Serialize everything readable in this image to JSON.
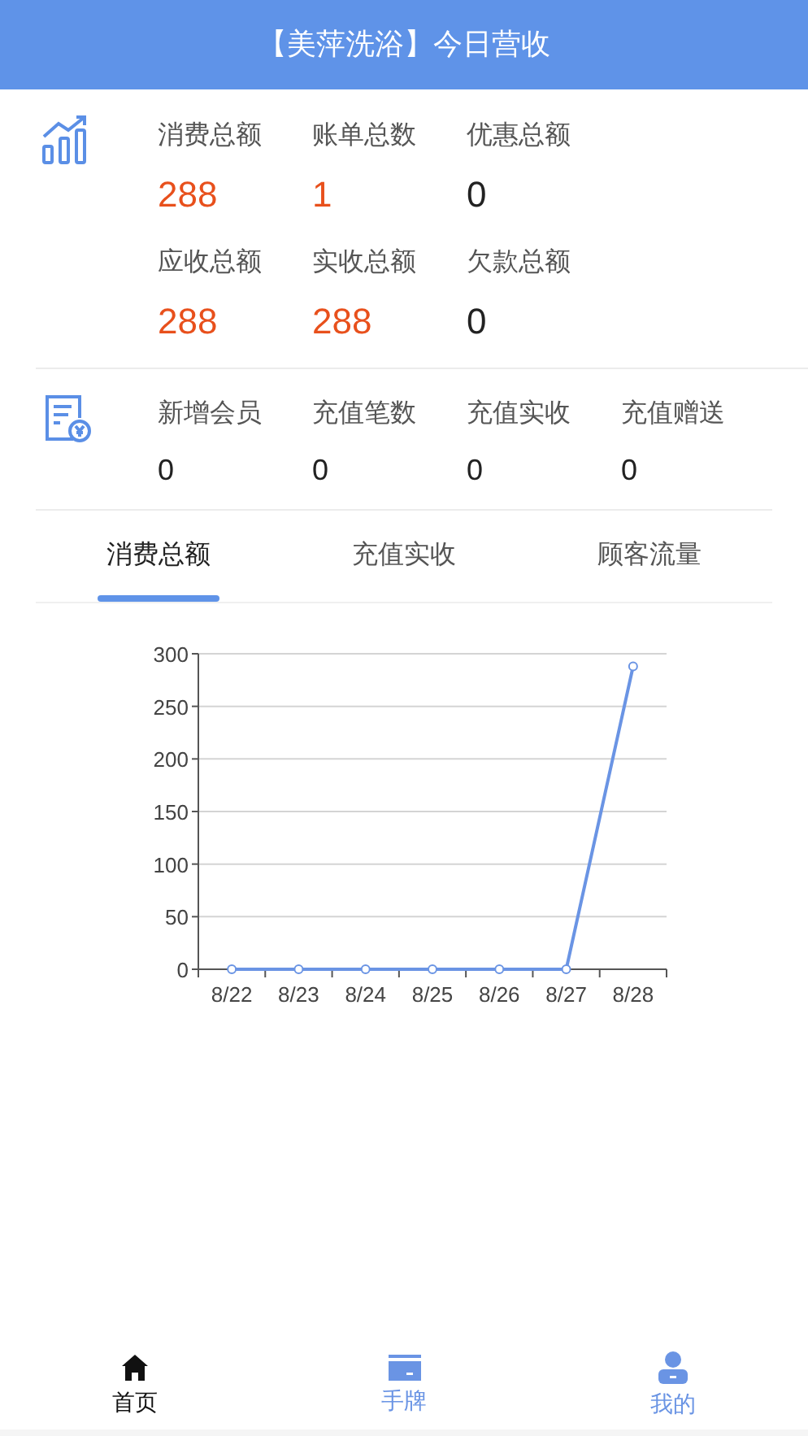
{
  "header": {
    "title": "【美萍洗浴】今日营收"
  },
  "summary": [
    {
      "label": "消费总额",
      "value": "288",
      "emphasis": true
    },
    {
      "label": "账单总数",
      "value": "1",
      "emphasis": true
    },
    {
      "label": "优惠总额",
      "value": "0",
      "emphasis": false
    },
    {
      "label": "应收总额",
      "value": "288",
      "emphasis": true
    },
    {
      "label": "实收总额",
      "value": "288",
      "emphasis": true
    },
    {
      "label": "欠款总额",
      "value": "0",
      "emphasis": false
    }
  ],
  "recharge": [
    {
      "label": "新增会员",
      "value": "0"
    },
    {
      "label": "充值笔数",
      "value": "0"
    },
    {
      "label": "充值实收",
      "value": "0"
    },
    {
      "label": "充值赠送",
      "value": "0"
    }
  ],
  "tabs": [
    {
      "label": "消费总额",
      "selected": true
    },
    {
      "label": "充值实收",
      "selected": false
    },
    {
      "label": "顾客流量",
      "selected": false
    }
  ],
  "chart_data": {
    "type": "line",
    "categories": [
      "8/22",
      "8/23",
      "8/24",
      "8/25",
      "8/26",
      "8/27",
      "8/28"
    ],
    "series": [
      {
        "color": "#6a94e4",
        "marker": true,
        "values": [
          0,
          0,
          0,
          0,
          0,
          0,
          288
        ]
      }
    ],
    "grid": true,
    "ylim": [
      0,
      300
    ],
    "yticks": [
      0,
      50,
      100,
      150,
      200,
      250,
      300
    ]
  },
  "bottom_nav": [
    {
      "label": "首页",
      "kind": "home",
      "selected": true
    },
    {
      "label": "手牌",
      "kind": "card",
      "selected": false
    },
    {
      "label": "我的",
      "kind": "user",
      "selected": false
    }
  ]
}
